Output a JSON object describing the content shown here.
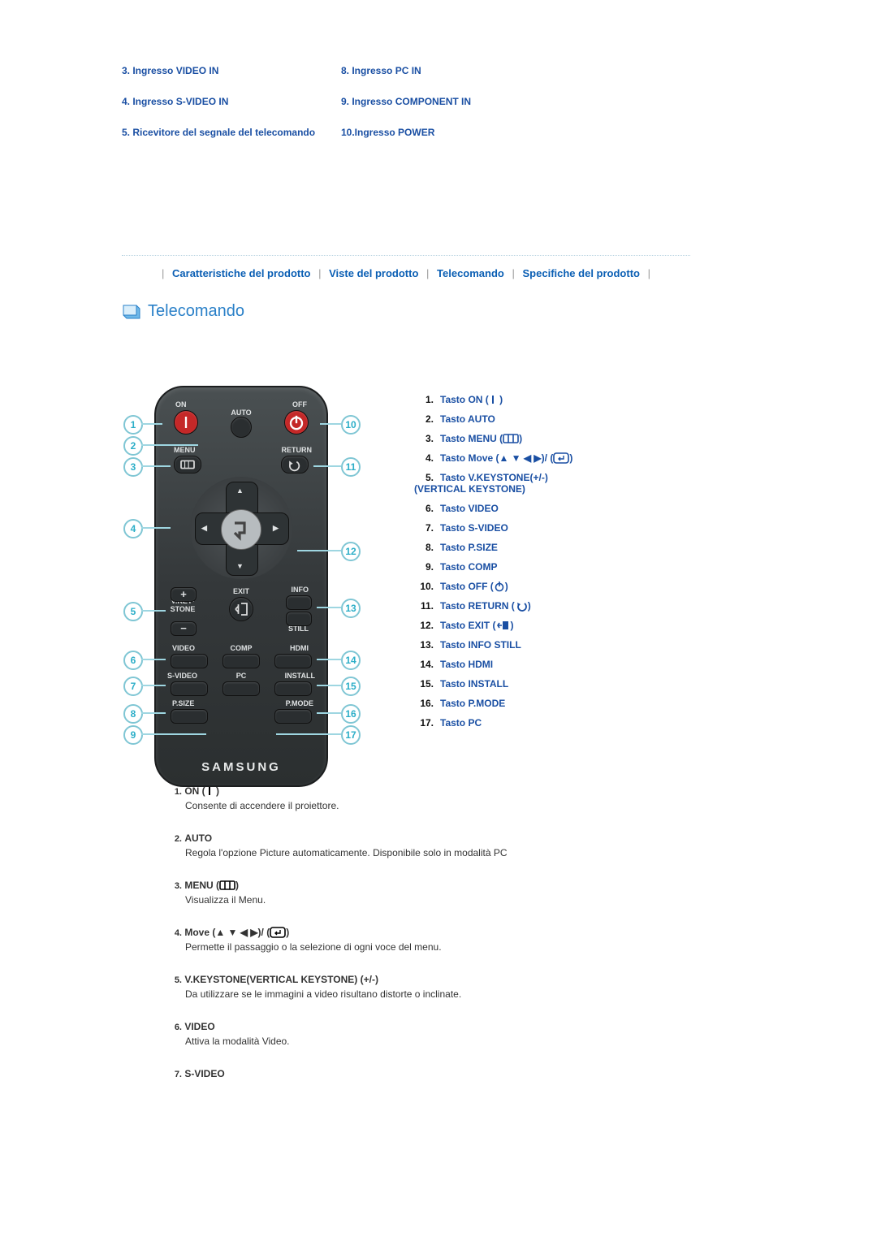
{
  "top_left": [
    "3. Ingresso VIDEO IN",
    "4. Ingresso S-VIDEO IN",
    "5. Ricevitore del segnale del telecomando"
  ],
  "top_right": [
    "8. Ingresso PC IN",
    "9. Ingresso COMPONENT IN",
    "10.Ingresso POWER"
  ],
  "nav": {
    "a": "Caratteristiche del prodotto",
    "b": "Viste del prodotto",
    "c": "Telecomando",
    "d": "Specifiche del prodotto"
  },
  "section_title": "Telecomando",
  "remote_labels": {
    "on": "ON",
    "off": "OFF",
    "auto": "AUTO",
    "menu": "MENU",
    "return": "RETURN",
    "vkey": "V.KEY-\nSTONE",
    "exit": "EXIT",
    "info": "INFO",
    "still": "STILL",
    "video": "VIDEO",
    "comp": "COMP",
    "hdmi": "HDMI",
    "svideo": "S-VIDEO",
    "pc": "PC",
    "install": "INSTALL",
    "psize": "P.SIZE",
    "pmode": "P.MODE",
    "brand": "SAMSUNG"
  },
  "list": [
    {
      "n": "1.",
      "l": "Tasto ON (",
      "icon": "on",
      "suffix": " )"
    },
    {
      "n": "2.",
      "l": "Tasto AUTO"
    },
    {
      "n": "3.",
      "l": "Tasto MENU (",
      "icon": "menu",
      "suffix": ")"
    },
    {
      "n": "4.",
      "l": "Tasto Move (▲ ▼ ◀ ▶)/ (",
      "icon": "enter",
      "suffix": ")"
    },
    {
      "n": "5.",
      "l": "Tasto V.KEYSTONE(+/-) (VERTICAL KEYSTONE)",
      "multi": true
    },
    {
      "n": "6.",
      "l": "Tasto VIDEO"
    },
    {
      "n": "7.",
      "l": "Tasto S-VIDEO"
    },
    {
      "n": "8.",
      "l": "Tasto P.SIZE"
    },
    {
      "n": "9.",
      "l": "Tasto COMP"
    },
    {
      "n": "10.",
      "l": "Tasto OFF (",
      "icon": "power",
      "suffix": ")"
    },
    {
      "n": "11.",
      "l": "Tasto RETURN (",
      "icon": "return",
      "suffix": ")"
    },
    {
      "n": "12.",
      "l": "Tasto EXIT (",
      "icon": "exit",
      "suffix": ")"
    },
    {
      "n": "13.",
      "l": "Tasto INFO STILL"
    },
    {
      "n": "14.",
      "l": "Tasto HDMI"
    },
    {
      "n": "15.",
      "l": "Tasto INSTALL"
    },
    {
      "n": "16.",
      "l": "Tasto P.MODE"
    },
    {
      "n": "17.",
      "l": "Tasto PC"
    }
  ],
  "descs": [
    {
      "n": "1.",
      "t": "ON (",
      "icon": "on",
      "suffix": " )",
      "b": "Consente di accendere il proiettore."
    },
    {
      "n": "2.",
      "t": "AUTO",
      "b": "Regola l'opzione Picture automaticamente. Disponibile solo in modalità PC"
    },
    {
      "n": "3.",
      "t": "MENU (",
      "icon": "menu",
      "suffix": ")",
      "b": "Visualizza il Menu."
    },
    {
      "n": "4.",
      "t": "Move (▲ ▼ ◀ ▶)/ (",
      "icon": "enter",
      "suffix": ")",
      "b": "Permette il passaggio o la selezione di ogni voce del menu."
    },
    {
      "n": "5.",
      "t": "V.KEYSTONE(VERTICAL KEYSTONE) (+/-)",
      "b": "Da utilizzare se le immagini a video risultano distorte o inclinate."
    },
    {
      "n": "6.",
      "t": "VIDEO",
      "b": "Attiva la modalità Video."
    },
    {
      "n": "7.",
      "t": "S-VIDEO",
      "b": ""
    }
  ]
}
